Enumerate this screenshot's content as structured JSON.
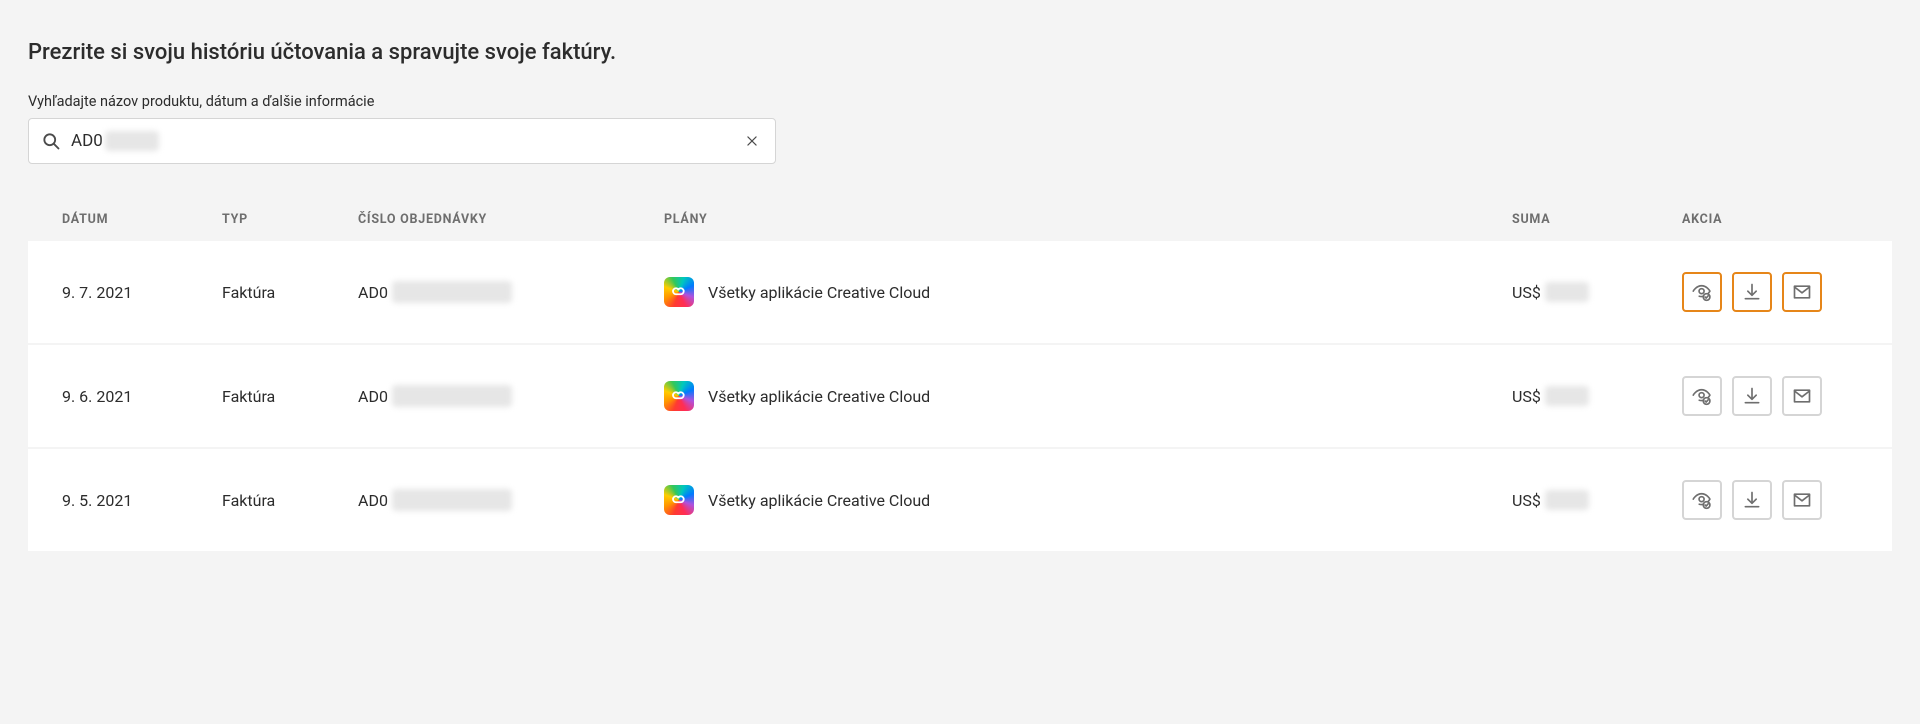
{
  "header": {
    "title": "Prezrite si svoju históriu účtovania a spravujte svoje faktúry.",
    "search_label": "Vyhľadajte názov produktu, dátum a ďalšie informácie",
    "search_value_prefix": "AD0"
  },
  "table": {
    "columns": {
      "date": "DÁTUM",
      "type": "TYP",
      "order": "ČÍSLO OBJEDNÁVKY",
      "plan": "PLÁNY",
      "amount": "SUMA",
      "action": "AKCIA"
    },
    "rows": [
      {
        "date": "9. 7. 2021",
        "type": "Faktúra",
        "order_prefix": "AD0",
        "plan": "Všetky aplikácie Creative Cloud",
        "amount_prefix": "US$",
        "highlighted": true
      },
      {
        "date": "9. 6. 2021",
        "type": "Faktúra",
        "order_prefix": "AD0",
        "plan": "Všetky aplikácie Creative Cloud",
        "amount_prefix": "US$",
        "highlighted": false
      },
      {
        "date": "9. 5. 2021",
        "type": "Faktúra",
        "order_prefix": "AD0",
        "plan": "Všetky aplikácie Creative Cloud",
        "amount_prefix": "US$",
        "highlighted": false
      }
    ]
  }
}
